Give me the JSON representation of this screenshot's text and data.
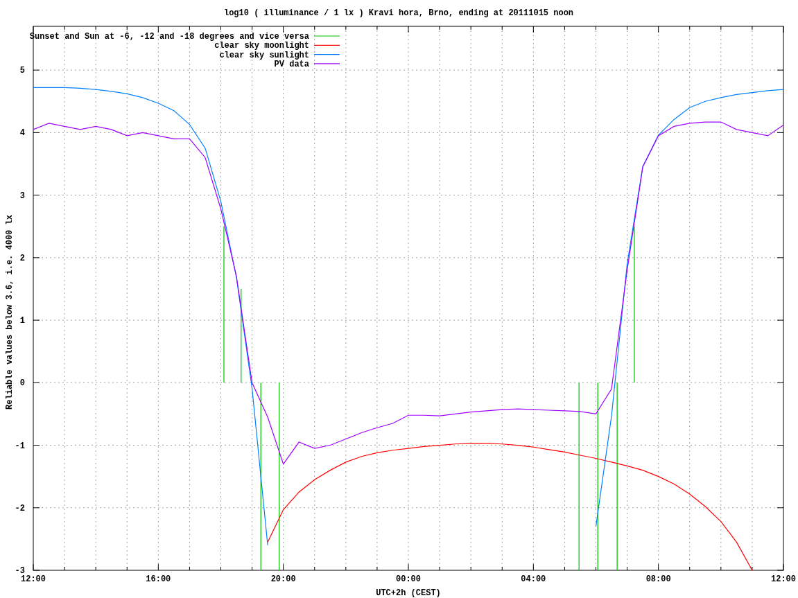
{
  "chart_data": {
    "type": "line",
    "title": "log10 ( illuminance / 1 lx ) Kravi hora, Brno, ending at 20111015 noon",
    "xlabel": "UTC+2h (CEST)",
    "ylabel": "Reliable values below 3.6, i.e. 4000 lx",
    "categories": [
      "12:00",
      null,
      null,
      null,
      null,
      null,
      null,
      null,
      "16:00",
      null,
      null,
      null,
      null,
      null,
      null,
      null,
      "20:00",
      null,
      null,
      null,
      null,
      null,
      null,
      null,
      "00:00",
      null,
      null,
      null,
      null,
      null,
      null,
      null,
      "04:00",
      null,
      null,
      null,
      null,
      null,
      null,
      null,
      "08:00",
      null,
      null,
      null,
      null,
      null,
      null,
      null,
      "12:00"
    ],
    "ylim": [
      -3,
      5.7
    ],
    "yticks": [
      -3,
      -2,
      -1,
      0,
      1,
      2,
      3,
      4,
      5
    ],
    "series": [
      {
        "name": "Sunset and Sun at -6, -12 and -18 degrees and vice versa",
        "color": "#00c000",
        "values": [
          null,
          null,
          null,
          null,
          null,
          null,
          null,
          null,
          null,
          null,
          null,
          null,
          null,
          null,
          null,
          null,
          null,
          null,
          null,
          null,
          null,
          null,
          null,
          null,
          null,
          null,
          null,
          null,
          null,
          null,
          null,
          null,
          null,
          null,
          null,
          null,
          null,
          null,
          null,
          null,
          null,
          null,
          null,
          null,
          null,
          null,
          null,
          null,
          null
        ]
      },
      {
        "name": "clear sky moonlight",
        "color": "#ff0000",
        "values": [
          null,
          null,
          null,
          null,
          null,
          null,
          null,
          null,
          null,
          null,
          null,
          null,
          null,
          null,
          null,
          -2.55,
          -2.03,
          -1.75,
          -1.55,
          -1.4,
          -1.27,
          -1.18,
          -1.12,
          -1.08,
          -1.05,
          -1.02,
          -1.0,
          -0.98,
          -0.97,
          -0.97,
          -0.98,
          -1.0,
          -1.03,
          -1.07,
          -1.11,
          -1.16,
          -1.21,
          -1.27,
          -1.33,
          -1.4,
          -1.5,
          -1.62,
          -1.78,
          -1.98,
          -2.22,
          -2.55,
          -3.0,
          null,
          null
        ]
      },
      {
        "name": "clear sky sunlight",
        "color": "#0080ff",
        "values": [
          4.72,
          4.72,
          4.72,
          4.71,
          4.69,
          4.66,
          4.62,
          4.56,
          4.47,
          4.35,
          4.13,
          3.75,
          2.9,
          1.68,
          -0.09,
          -2.6,
          null,
          null,
          null,
          null,
          null,
          null,
          null,
          null,
          null,
          null,
          null,
          null,
          null,
          null,
          null,
          null,
          null,
          null,
          null,
          null,
          -2.3,
          -0.53,
          1.9,
          3.46,
          3.96,
          4.21,
          4.4,
          4.5,
          4.56,
          4.61,
          4.64,
          4.67,
          4.69
        ]
      },
      {
        "name": "PV data",
        "color": "#a000ff",
        "values": [
          4.05,
          4.15,
          4.1,
          4.05,
          4.1,
          4.05,
          3.95,
          4.0,
          3.95,
          3.9,
          3.9,
          3.6,
          2.78,
          1.7,
          0.0,
          -0.55,
          -1.3,
          -0.95,
          -1.05,
          -1.0,
          -0.9,
          -0.8,
          -0.72,
          -0.65,
          -0.52,
          -0.52,
          -0.53,
          -0.5,
          -0.47,
          -0.45,
          -0.43,
          -0.42,
          -0.43,
          -0.44,
          -0.45,
          -0.46,
          -0.5,
          -0.1,
          1.8,
          3.45,
          3.95,
          4.1,
          4.15,
          4.17,
          4.17,
          4.05,
          4.0,
          3.95,
          4.12
        ]
      }
    ],
    "grid": true,
    "legend": true
  }
}
